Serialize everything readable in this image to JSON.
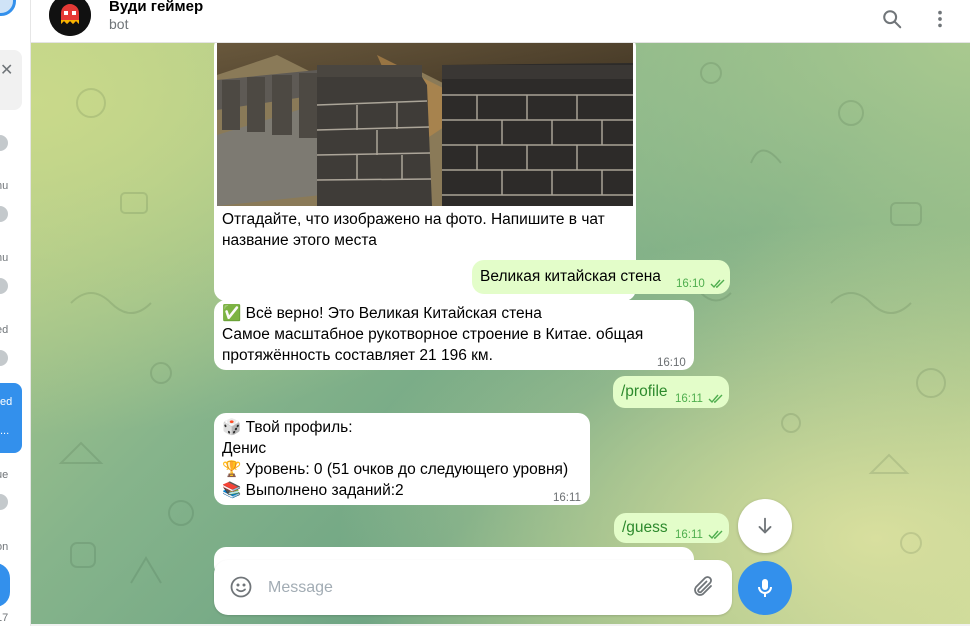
{
  "sidebar": {
    "fragments": [
      "nu",
      "nu",
      "ed",
      "ue",
      "on",
      "17"
    ],
    "active_fragments": [
      "ed",
      "..."
    ]
  },
  "header": {
    "title": "Вуди геймер",
    "subtitle": "bot",
    "search_icon": "search-icon",
    "menu_icon": "more-vertical-icon"
  },
  "messages": [
    {
      "type": "in",
      "has_photo": true,
      "photo_subject": "Great Wall of China",
      "lines": [
        "Отгадайте, что изображено на фото. Напишите в чат",
        "название этого места"
      ],
      "time": "16:10"
    },
    {
      "type": "out",
      "text": "Великая китайская стена",
      "time": "16:10",
      "status": "read"
    },
    {
      "type": "in",
      "lines": [
        "✅ Всё верно! Это Великая Китайская стена",
        "Самое масштабное рукотворное строение в Китае. общая",
        "протяжённость составляет 21 196 км."
      ],
      "time": "16:10"
    },
    {
      "type": "out",
      "text": "/profile",
      "time": "16:11",
      "status": "read"
    },
    {
      "type": "in",
      "lines": [
        "🎲 Твой профиль:",
        "Денис",
        "🏆 Уровень: 0 (51 очков до следующего уровня)",
        "📚 Выполнено заданий:2"
      ],
      "time": "16:11"
    },
    {
      "type": "out",
      "text": "/guess",
      "time": "16:11",
      "status": "read"
    }
  ],
  "composer": {
    "placeholder": "Message",
    "emoji_icon": "smile-icon",
    "attach_icon": "paperclip-icon",
    "mic_icon": "microphone-icon"
  },
  "scroll_button_icon": "arrow-down-icon",
  "colors": {
    "accent": "#3390ec",
    "outgoing_bubble": "#e3fdc9",
    "incoming_bubble": "#ffffff",
    "read_check": "#4fae4e"
  }
}
